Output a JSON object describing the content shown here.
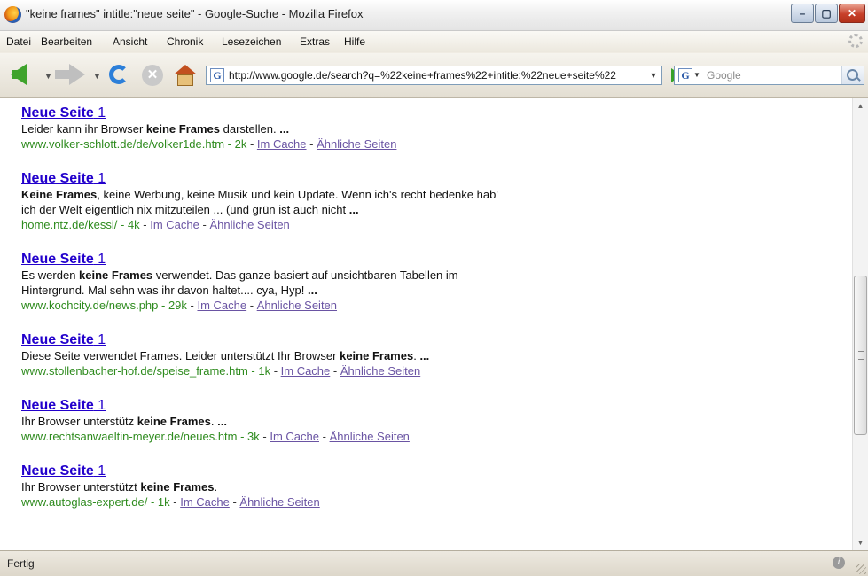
{
  "window": {
    "title": "\"keine frames\" intitle:\"neue seite\" - Google-Suche - Mozilla Firefox",
    "minimize_label": "–",
    "maximize_label": "▢",
    "close_label": "✕"
  },
  "menu": {
    "items": [
      "Datei",
      "Bearbeiten",
      "Ansicht",
      "Chronik",
      "Lesezeichen",
      "Extras",
      "Hilfe"
    ]
  },
  "toolbar": {
    "url": "http://www.google.de/search?q=%22keine+frames%22+intitle:%22neue+seite%22",
    "search_engine_letter": "G",
    "search_placeholder": "Google",
    "stop_glyph": "✕"
  },
  "results": [
    {
      "title_main": "Neue Seite",
      "title_num": "1",
      "snippet_html": "Leider kann ihr Browser <b>keine Frames</b> darstellen. <b>...</b>",
      "url": "www.volker-schlott.de/de/volker1de.htm - 2k",
      "cache_label": "Im Cache",
      "similar_label": "Ähnliche Seiten"
    },
    {
      "title_main": "Neue Seite",
      "title_num": "1",
      "snippet_html": "<b>Keine Frames</b>, keine Werbung, keine Musik und kein Update. Wenn ich's recht bedenke hab'<br>ich der Welt eigentlich nix mitzuteilen ... (und grün ist auch nicht <b>...</b>",
      "url": "home.ntz.de/kessi/ - 4k",
      "cache_label": "Im Cache",
      "similar_label": "Ähnliche Seiten"
    },
    {
      "title_main": "Neue Seite",
      "title_num": "1",
      "snippet_html": "Es werden <b>keine Frames</b> verwendet. Das ganze basiert auf unsichtbaren Tabellen im<br>Hintergrund. Mal sehn was ihr davon haltet.... cya, Hyp! <b>...</b>",
      "url": "www.kochcity.de/news.php - 29k",
      "cache_label": "Im Cache",
      "similar_label": "Ähnliche Seiten"
    },
    {
      "title_main": "Neue Seite",
      "title_num": "1",
      "snippet_html": "Diese Seite verwendet Frames. Leider unterstützt Ihr Browser <b>keine Frames</b>. <b>...</b>",
      "url": "www.stollenbacher-hof.de/speise_frame.htm - 1k",
      "cache_label": "Im Cache",
      "similar_label": "Ähnliche Seiten"
    },
    {
      "title_main": "Neue Seite",
      "title_num": "1",
      "snippet_html": "Ihr Browser unterstütz <b>keine Frames</b>. <b>...</b>",
      "url": "www.rechtsanwaeltin-meyer.de/neues.htm - 3k",
      "cache_label": "Im Cache",
      "similar_label": "Ähnliche Seiten"
    },
    {
      "title_main": "Neue Seite",
      "title_num": "1",
      "snippet_html": "Ihr Browser unterstützt <b>keine Frames</b>.",
      "url": "www.autoglas-expert.de/ - 1k",
      "cache_label": "Im Cache",
      "similar_label": "Ähnliche Seiten"
    }
  ],
  "status": {
    "text": "Fertig"
  }
}
